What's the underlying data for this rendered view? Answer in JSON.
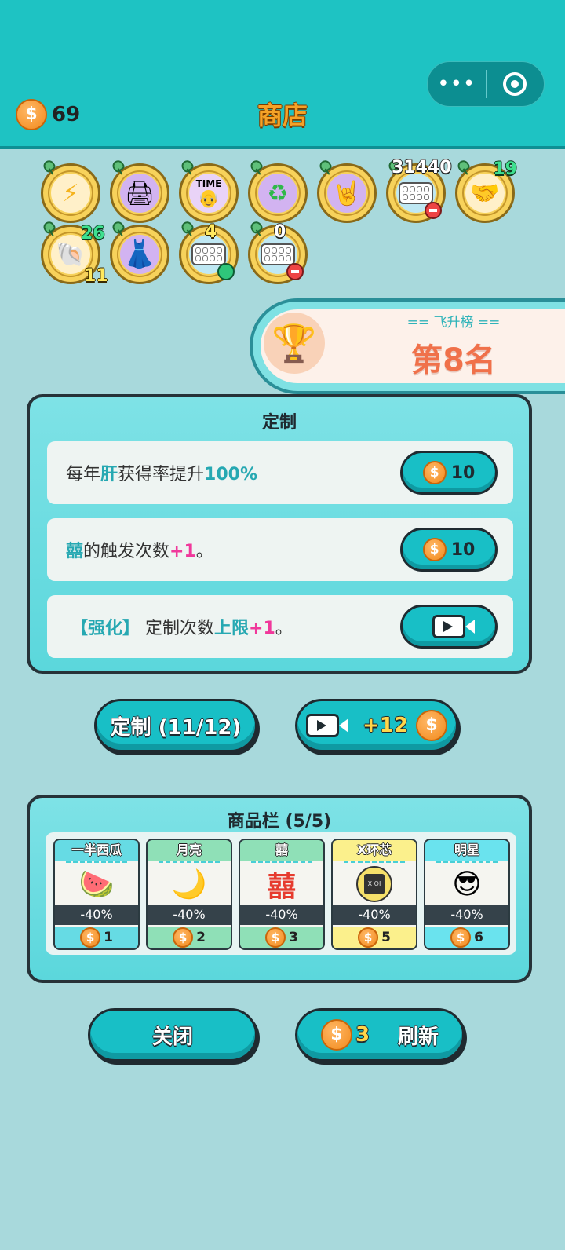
{
  "header": {
    "coins": "69",
    "title": "商店",
    "menu_icon": "more-dots-icon",
    "close_icon": "target-icon"
  },
  "badges": [
    {
      "icon": "lightning-icon"
    },
    {
      "icon": "printer-icon"
    },
    {
      "icon": "magazine-icon",
      "label": "TIME"
    },
    {
      "icon": "recycle-icon"
    },
    {
      "icon": "rock-hand-icon"
    },
    {
      "icon": "egg-tray-icon",
      "count": "31440"
    },
    {
      "icon": "handshake-icon",
      "count": "19"
    },
    {
      "icon": "shell-icon",
      "count": "26",
      "sub": "11"
    },
    {
      "icon": "skirt-icon"
    },
    {
      "icon": "egg-tray-icon",
      "count": "4"
    },
    {
      "icon": "egg-tray-icon",
      "count": "0"
    }
  ],
  "ranking": {
    "label": "== 飞升榜 ==",
    "place": "第8名"
  },
  "custom_panel": {
    "title": "定制",
    "rows": [
      {
        "pre": "每年",
        "hl": "肝",
        "mid": "获得率提升",
        "hl2": "100%",
        "post": "",
        "price": "10"
      },
      {
        "pre": "",
        "hl": "囍",
        "mid": "的触发次数",
        "hl2": "+1",
        "post": "。",
        "price": "10"
      },
      {
        "pre": "",
        "hl": "【强化】",
        "mid": "定制次数",
        "hl2": "上限",
        "hl3": "+1",
        "post": "。",
        "action": "video"
      }
    ]
  },
  "actions": {
    "custom_label": "定制 (11/12)",
    "video_bonus": "+12"
  },
  "shop": {
    "title": "商品栏 (5/5)",
    "items": [
      {
        "name": "一半西瓜",
        "discount": "-40%",
        "price": "1",
        "color": "#66dbe4",
        "icon": "🍉"
      },
      {
        "name": "月亮",
        "discount": "-40%",
        "price": "2",
        "color": "#8fe0b7",
        "icon": "🌙"
      },
      {
        "name": "囍",
        "discount": "-40%",
        "price": "3",
        "color": "#8fe0b7",
        "icon": "囍"
      },
      {
        "name": "X环芯",
        "discount": "-40%",
        "price": "5",
        "color": "#fbf08c",
        "icon": "X OI"
      },
      {
        "name": "明星",
        "discount": "-40%",
        "price": "6",
        "color": "#6ae3ee",
        "icon": "😎"
      }
    ]
  },
  "footer": {
    "close_label": "关闭",
    "refresh_cost": "3",
    "refresh_label": "刷新"
  },
  "colors": {
    "accent": "#1ec3c3",
    "background": "#a8d9dc",
    "coin": "#f28a1c"
  }
}
